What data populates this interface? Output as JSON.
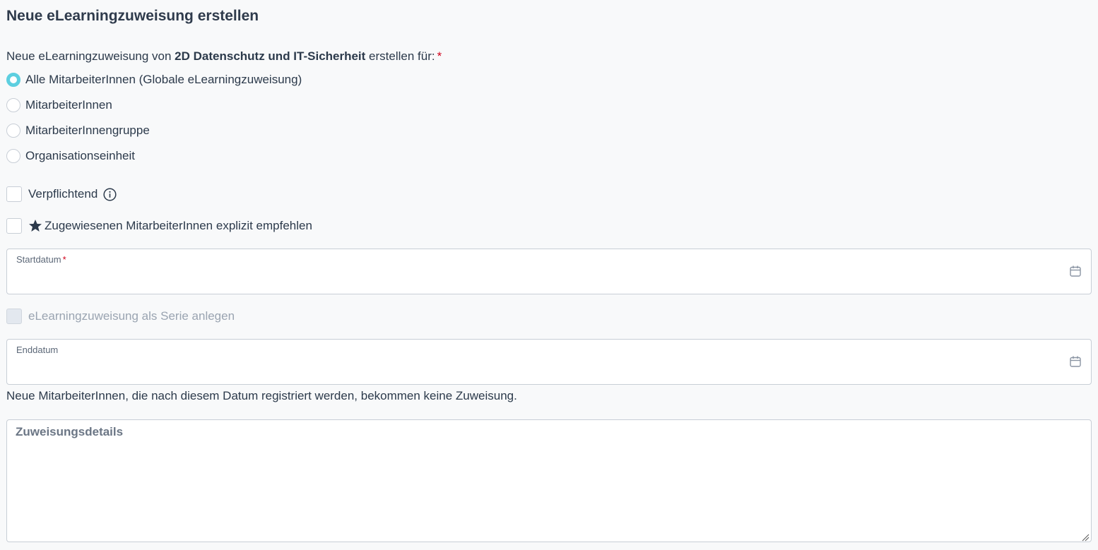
{
  "page": {
    "title": "Neue eLearningzuweisung erstellen"
  },
  "intro": {
    "prefix": "Neue eLearningzuweisung von ",
    "course": "2D Datenschutz und IT-Sicherheit",
    "suffix": " erstellen für:",
    "required_mark": "*"
  },
  "assignment_target": {
    "selected": "Alle MitarbeiterInnen (Globale eLearningzuweisung)",
    "options": [
      {
        "label": "Alle MitarbeiterInnen (Globale eLearningzuweisung)",
        "checked": true
      },
      {
        "label": "MitarbeiterInnen",
        "checked": false
      },
      {
        "label": "MitarbeiterInnengruppe",
        "checked": false
      },
      {
        "label": "Organisationseinheit",
        "checked": false
      }
    ]
  },
  "options": {
    "mandatory_label": "Verpflichtend",
    "mandatory_checked": false,
    "recommend_label": "Zugewiesenen MitarbeiterInnen explizit empfehlen",
    "recommend_checked": false,
    "series_label": "eLearningzuweisung als Serie anlegen",
    "series_checked": false,
    "series_disabled": true
  },
  "start_date": {
    "label": "Startdatum",
    "required_mark": "*",
    "value": ""
  },
  "end_date": {
    "label": "Enddatum",
    "value": "",
    "hint": "Neue MitarbeiterInnen, die nach diesem Datum registriert werden, bekommen keine Zuweisung."
  },
  "details": {
    "placeholder": "Zuweisungsdetails",
    "value": ""
  },
  "colors": {
    "text": "#2c3a4b",
    "required": "#d0021b",
    "radio_selected": "#5dcfe0",
    "border": "#c8ced6",
    "background": "#f8f9fa"
  },
  "icons": {
    "info": "info-circle-icon",
    "star": "star-icon",
    "calendar": "calendar-icon"
  }
}
